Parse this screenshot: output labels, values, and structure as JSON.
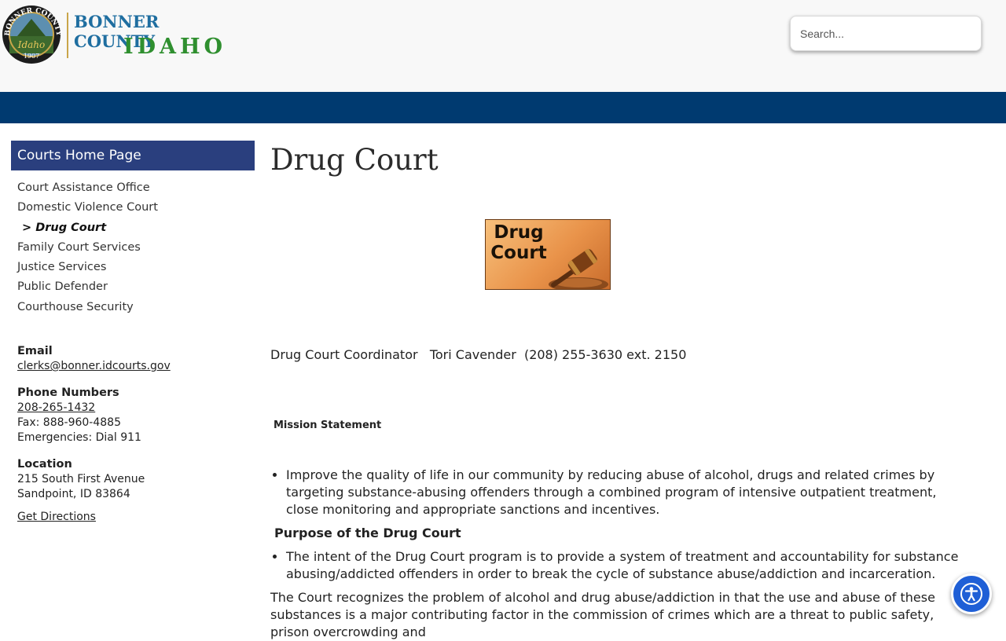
{
  "header": {
    "logo_line1": "BONNER COUNTY",
    "logo_line2": "IDAHO",
    "seal_top": "BONNER COUNTY",
    "seal_year": "1907",
    "search_placeholder": "Search..."
  },
  "sidebar": {
    "title": "Courts Home Page",
    "items": [
      {
        "label": "Court Assistance Office",
        "active": false
      },
      {
        "label": "Domestic Violence Court",
        "active": false
      },
      {
        "label": "> Drug Court",
        "active": true
      },
      {
        "label": "Family Court Services",
        "active": false
      },
      {
        "label": "Justice Services",
        "active": false
      },
      {
        "label": "Public Defender",
        "active": false
      },
      {
        "label": "Courthouse Security",
        "active": false
      }
    ],
    "contact": {
      "email_label": "Email",
      "email": "clerks@bonner.idcourts.gov",
      "phone_label": "Phone Numbers",
      "phone": "208-265-1432",
      "fax": "Fax: 888-960-4885",
      "emergency": "Emergencies: Dial 911",
      "location_label": "Location",
      "address1": "215 South First Avenue",
      "address2": "Sandpoint, ID 83864",
      "directions": "Get Directions"
    }
  },
  "main": {
    "title": "Drug Court",
    "banner_line1": "Drug",
    "banner_line2": "Court",
    "coordinator": "Drug Court Coordinator   Tori Cavender  (208) 255-3630 ext. 2150",
    "mission_heading": "Mission Statement",
    "mission_bullet": "Improve the quality of life in our community by reducing abuse of alcohol, drugs and related crimes by targeting substance-abusing offenders through a combined program of intensive outpatient treatment, close monitoring and appropriate sanctions and incentives.",
    "purpose_heading": "Purpose of the Drug Court",
    "purpose_bullet": "The intent of the Drug Court program is to provide a system of treatment and accountability for substance abusing/addicted offenders in order to break the cycle of substance abuse/addiction and incarceration.",
    "paragraph": "The Court recognizes the problem of alcohol and drug abuse/addiction in that the use and abuse of these substances is a major contributing factor in the commission of crimes which are a threat to public safety, prison overcrowding and"
  },
  "colors": {
    "nav_bar": "#003a70",
    "sidebar_title_bg": "#2a3f7e",
    "accessibility_button": "#1f5fd6"
  }
}
